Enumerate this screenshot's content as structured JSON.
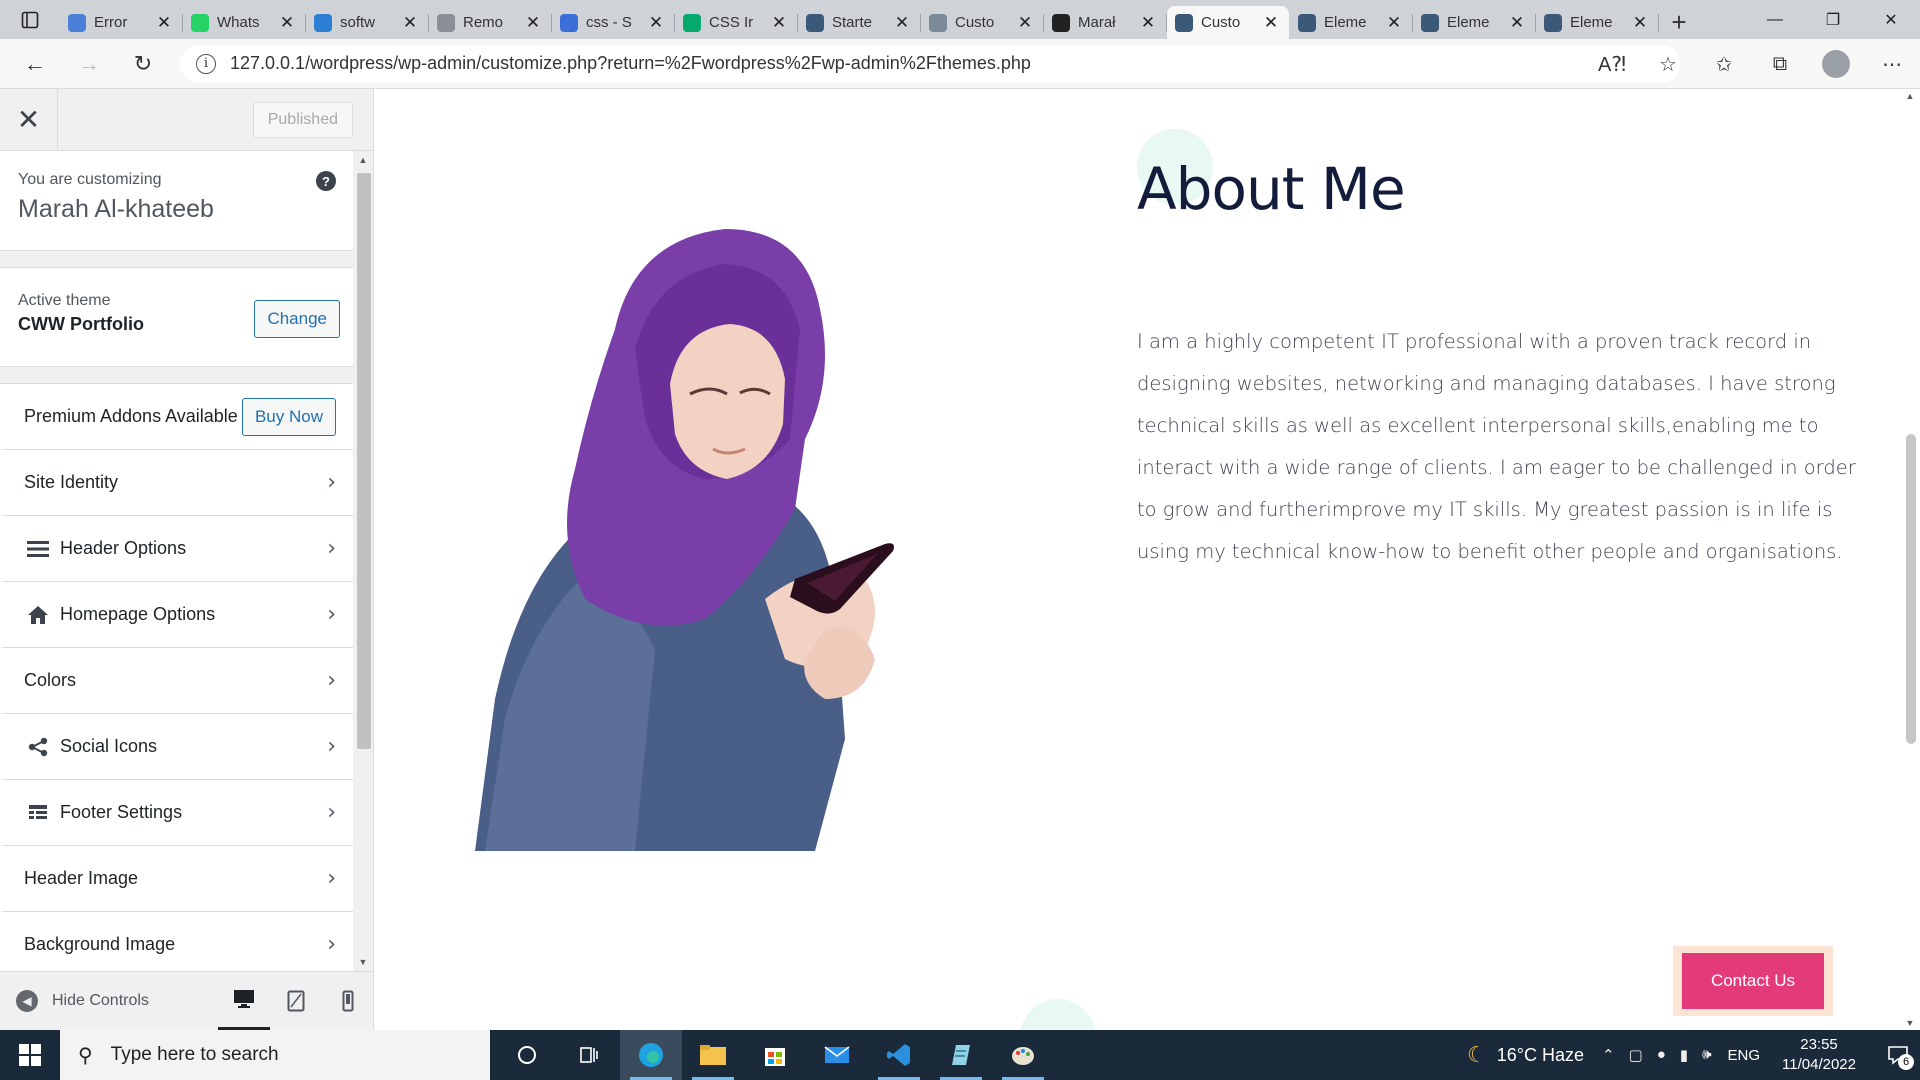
{
  "browser": {
    "tabs": [
      {
        "title": "Error",
        "icon": "error-page-icon",
        "color": "#4c7fd6"
      },
      {
        "title": "Whats",
        "icon": "whatsapp-icon",
        "color": "#25d366"
      },
      {
        "title": "softw",
        "icon": "bing-icon",
        "color": "#2a7fd4"
      },
      {
        "title": "Remo",
        "icon": "remove-bg-icon",
        "color": "#8a8f98"
      },
      {
        "title": "css - S",
        "icon": "search-icon",
        "color": "#3b6fd8"
      },
      {
        "title": "CSS Ir",
        "icon": "w3schools-icon",
        "color": "#04aa6d"
      },
      {
        "title": "Starte",
        "icon": "wordpress-icon",
        "color": "#3b5a7a"
      },
      {
        "title": "Custo",
        "icon": "wordpress-icon",
        "color": "#7b8a99"
      },
      {
        "title": "Marał",
        "icon": "github-icon",
        "color": "#222222"
      },
      {
        "title": "Custo",
        "icon": "wordpress-icon",
        "color": "#3b5a7a",
        "active": true
      },
      {
        "title": "Eleme",
        "icon": "wordpress-icon",
        "color": "#3b5a7a"
      },
      {
        "title": "Eleme",
        "icon": "wordpress-icon",
        "color": "#3b5a7a"
      },
      {
        "title": "Eleme",
        "icon": "wordpress-icon",
        "color": "#3b5a7a"
      }
    ],
    "url": "127.0.0.1/wordpress/wp-admin/customize.php?return=%2Fwordpress%2Fwp-admin%2Fthemes.php"
  },
  "customizer": {
    "published_label": "Published",
    "customizing_label": "You are customizing",
    "site_name": "Marah Al-khateeb",
    "active_theme_label": "Active theme",
    "theme_name": "CWW Portfolio",
    "change_label": "Change",
    "premium_label": "Premium Addons Available",
    "buy_label": "Buy Now",
    "sections": [
      {
        "label": "Site Identity",
        "icon": ""
      },
      {
        "label": "Header Options",
        "icon": "menu-icon"
      },
      {
        "label": "Homepage Options",
        "icon": "home-icon"
      },
      {
        "label": "Colors",
        "icon": ""
      },
      {
        "label": "Social Icons",
        "icon": "share-icon"
      },
      {
        "label": "Footer Settings",
        "icon": "footer-icon"
      },
      {
        "label": "Header Image",
        "icon": ""
      },
      {
        "label": "Background Image",
        "icon": ""
      }
    ],
    "hide_controls_label": "Hide Controls"
  },
  "preview": {
    "about_title": "About Me",
    "about_text": "I am a highly competent IT professional with a proven track record in designing websites, networking and managing databases. I have strong technical skills as well as excellent interpersonal skills,enabling me to interact with a wide range of clients. I am eager to be challenged in order to grow and furtherimprove my IT skills. My greatest passion is in life is using my technical know-how to benefit other people and organisations.",
    "contact_label": "Contact Us",
    "accent_color": "#e33b7a"
  },
  "taskbar": {
    "search_placeholder": "Type here to search",
    "weather": "16°C  Haze",
    "language": "ENG",
    "time": "23:55",
    "date": "11/04/2022",
    "notification_count": "6"
  }
}
